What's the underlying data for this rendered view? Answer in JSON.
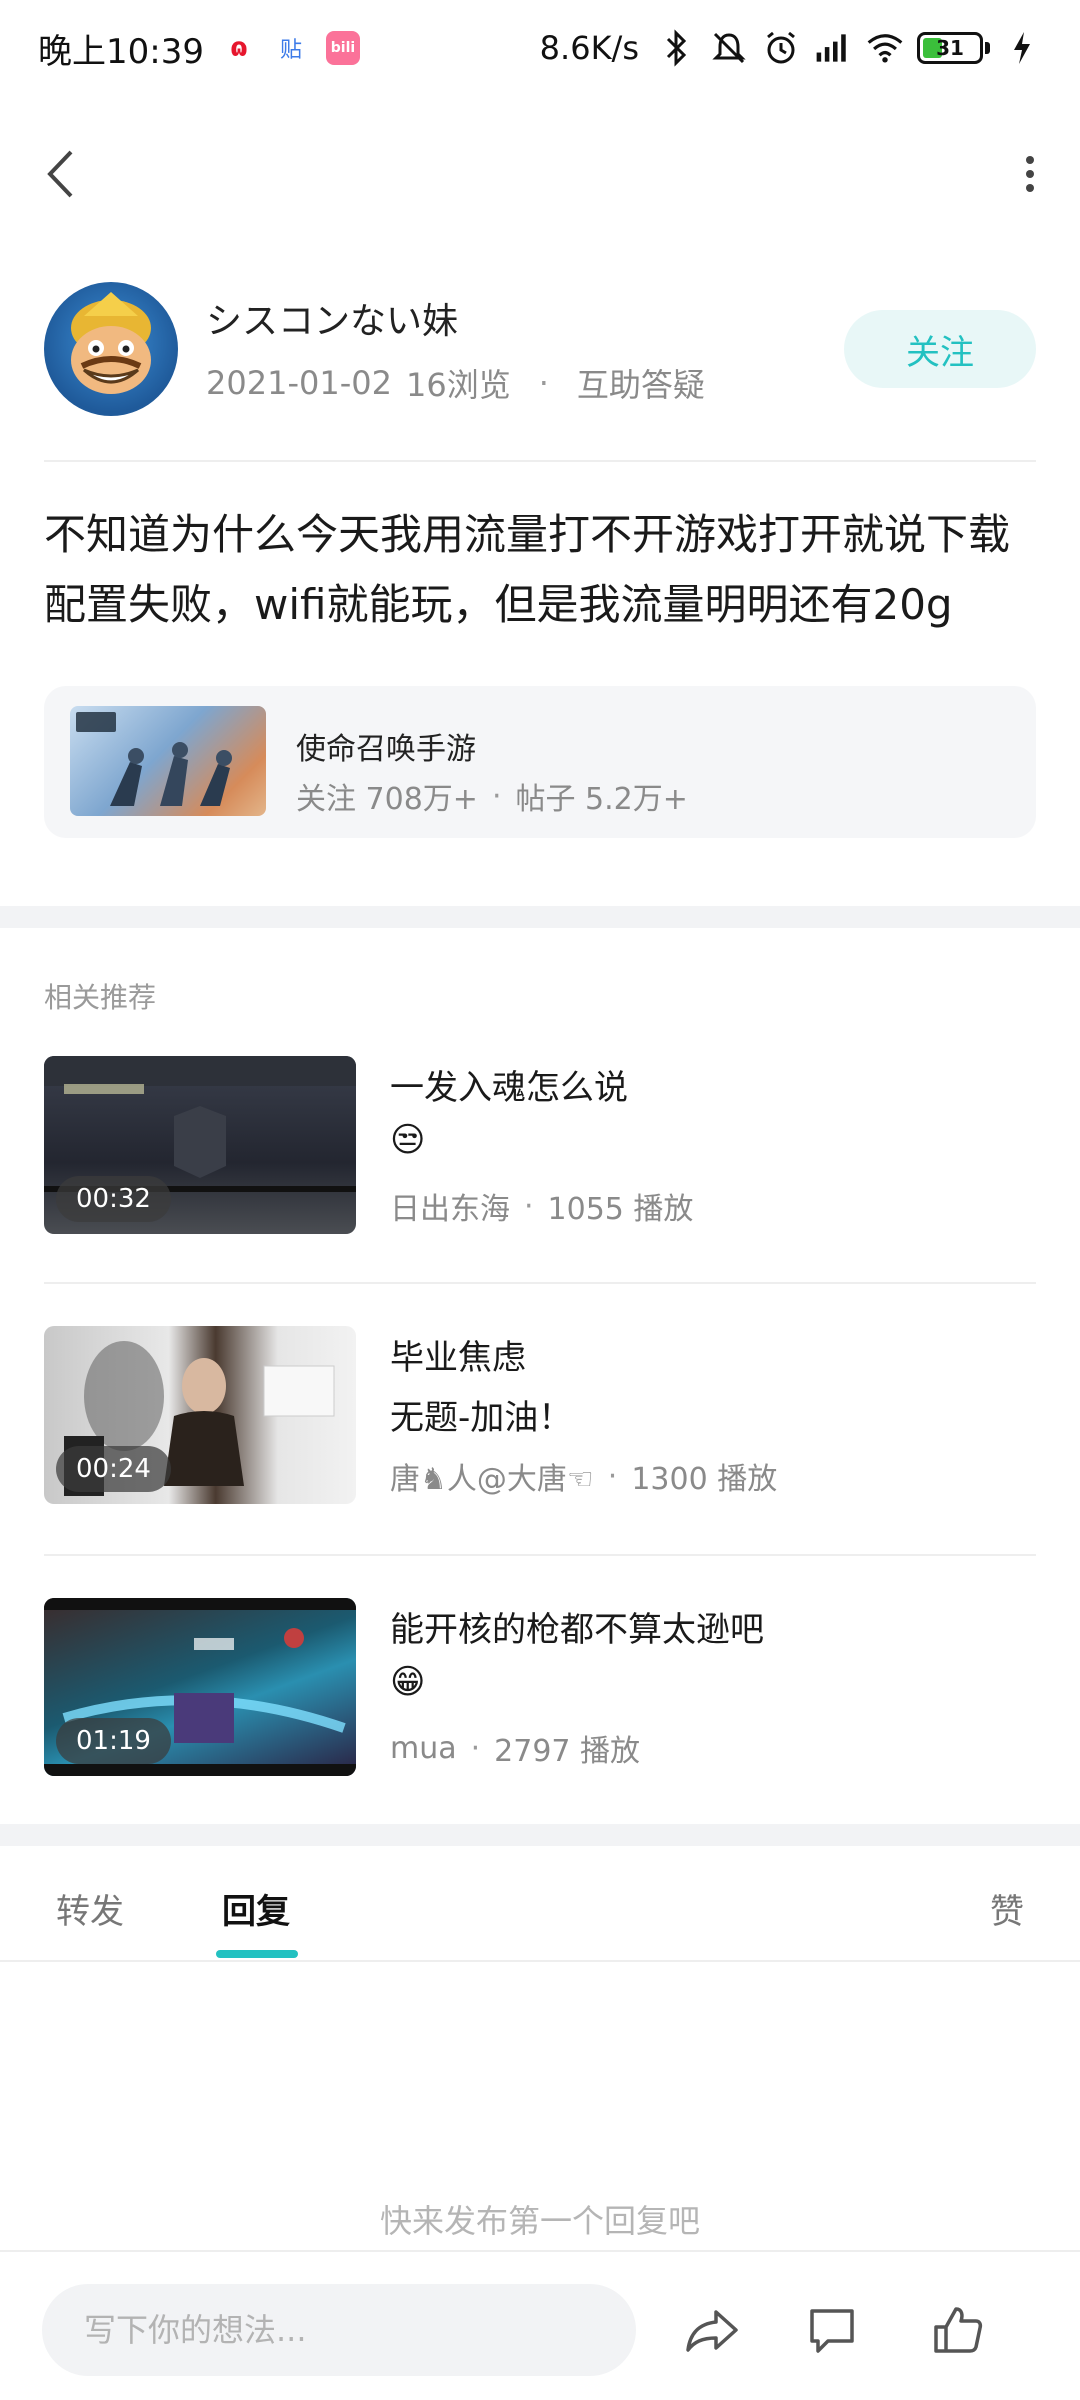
{
  "status_bar": {
    "time": "晚上10:39",
    "net_speed": "8.6K/s",
    "battery_level": "31",
    "apps": [
      "weibo-icon",
      "tieba-icon",
      "bilibili-icon"
    ]
  },
  "nav": {
    "back_icon": "chevron-left-icon",
    "more_icon": "more-vertical-icon"
  },
  "author": {
    "name": "シスコンない妹",
    "date": "2021-01-02",
    "views": "16浏览",
    "category": "互助答疑",
    "follow_label": "关注"
  },
  "post": {
    "text": "不知道为什么今天我用流量打不开游戏打开就说下载配置失败，wifi就能玩，但是我流量明明还有20g"
  },
  "game_card": {
    "name": "使命召唤手游",
    "followers": "关注 708万+",
    "posts": "帖子 5.2万+"
  },
  "related": {
    "title": "相关推荐",
    "items": [
      {
        "duration": "00:32",
        "title": "一发入魂怎么说",
        "subtitle": "😒",
        "author": "日出东海",
        "plays": "1055 播放"
      },
      {
        "duration": "00:24",
        "title": "毕业焦虑",
        "subtitle": "无题-加油！",
        "author": "唐♞人@大唐☜",
        "plays": "1300 播放"
      },
      {
        "duration": "01:19",
        "title": "能开核的枪都不算太逊吧",
        "subtitle": "😁",
        "author": "mua",
        "plays": "2797 播放"
      }
    ]
  },
  "tabs": {
    "forward": "转发",
    "reply": "回复",
    "like": "赞",
    "active": "reply"
  },
  "replies": {
    "empty_text": "快来发布第一个回复吧"
  },
  "bottom_bar": {
    "input_placeholder": "写下你的想法...",
    "share_icon": "share-icon",
    "comment_icon": "comment-icon",
    "like_icon": "thumbs-up-icon"
  },
  "colors": {
    "accent": "#23c1c1",
    "follow_bg": "#e8f7f7",
    "muted_text": "#8a8a8a"
  }
}
